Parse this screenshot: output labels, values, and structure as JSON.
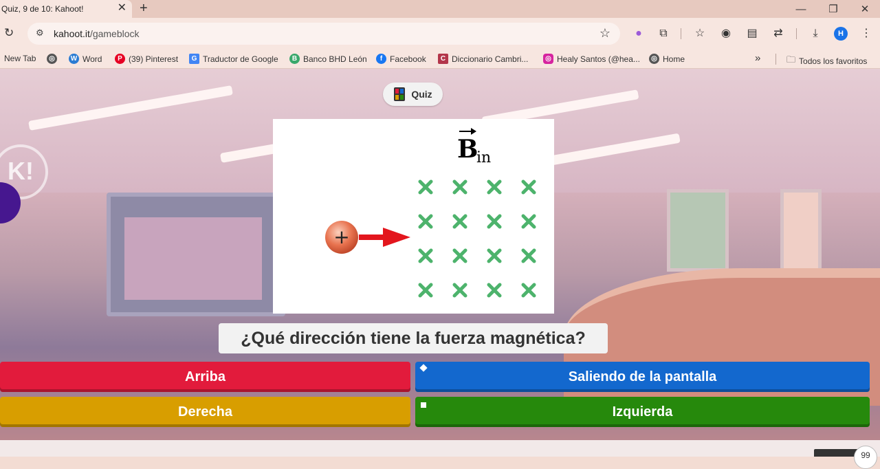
{
  "browser": {
    "tab_title": "Quiz, 9 de 10: Kahoot!",
    "url_host": "kahoot.it",
    "url_path": "/gameblock",
    "profile_initial": "H"
  },
  "bookmarks": [
    {
      "label": "New Tab"
    },
    {
      "label": ""
    },
    {
      "label": "Word"
    },
    {
      "label": "(39) Pinterest"
    },
    {
      "label": "Traductor de Google"
    },
    {
      "label": "Banco BHD León"
    },
    {
      "label": "Facebook"
    },
    {
      "label": "Diccionario Cambri..."
    },
    {
      "label": "Healy Santos (@hea..."
    },
    {
      "label": "Home"
    }
  ],
  "bookmarks_more": "»",
  "all_bookmarks": "Todos los favoritos",
  "game": {
    "mode_label": "Quiz",
    "question": "¿Qué dirección tiene la fuerza magnética?",
    "figure": {
      "field_label": "B",
      "field_subscript": "in",
      "charge_symbol": "+"
    },
    "answers": [
      {
        "label": "Arriba",
        "color": "#e21b3c",
        "shape": "triangle"
      },
      {
        "label": "Saliendo de la pantalla",
        "color": "#1368ce",
        "shape": "diamond"
      },
      {
        "label": "Derecha",
        "color": "#d89e00",
        "shape": "circle"
      },
      {
        "label": "Izquierda",
        "color": "#26890c",
        "shape": "square"
      }
    ]
  },
  "footer": {
    "counter": "99"
  }
}
